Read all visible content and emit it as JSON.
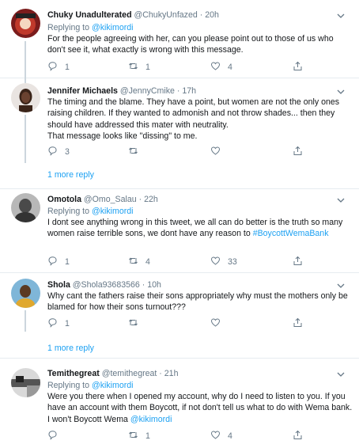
{
  "tweets": [
    {
      "name": "Chuky Unadulterated",
      "handle": "@ChukyUnfazed",
      "time": "20h",
      "replying_prefix": "Replying to",
      "replying_to": "@kikimordi",
      "text": "For the people agreeing with her, can you please point out to those of us who don't see it, what exactly is wrong with this message.",
      "replies": "1",
      "retweets": "1",
      "likes": "4"
    },
    {
      "name": "Jennifer Michaels",
      "handle": "@JennyCmike",
      "time": "17h",
      "text": "The timing and the blame. They have a point, but women are not the only ones raising children. If they wanted to admonish and not throw shades... then they should have addressed this mater with neutrality.\nThat message looks like \"dissing\" to me.",
      "replies": "3",
      "retweets": "",
      "likes": ""
    },
    {
      "name": "Omotola",
      "handle": "@Omo_Salau",
      "time": "22h",
      "replying_prefix": "Replying to",
      "replying_to": "@kikimordi",
      "text": "I dont see anything wrong in this tweet, we all can do better is the truth so many women raise terrible sons, we dont have any reason to",
      "hashtag": "#BoycottWemaBank",
      "replies": "1",
      "retweets": "4",
      "likes": "33"
    },
    {
      "name": "Shola",
      "handle": "@Shola93683566",
      "time": "10h",
      "text": "Why cant the fathers raise their sons appropriately why must the mothers only be blamed for how their sons turnout???",
      "replies": "1",
      "retweets": "",
      "likes": ""
    },
    {
      "name": "Temithegreat",
      "handle": "@temithegreat",
      "time": "21h",
      "replying_prefix": "Replying to",
      "replying_to": "@kikimordi",
      "text": "Were you there when I opened my account, why do I need to listen to you. If you have an account with them Boycott, if not don't tell us what to do with Wema bank. I won't Boycott Wema",
      "text_mention": "@kikimordi",
      "replies": "",
      "retweets": "1",
      "likes": "4"
    }
  ],
  "more_replies": "1 more reply",
  "dot": "·",
  "colors": {
    "text": "#14171a",
    "muted": "#657786",
    "link": "#1da1f2",
    "border": "#e6ecf0"
  },
  "icons": [
    "reply-icon",
    "retweet-icon",
    "like-icon",
    "share-icon",
    "caret-down-icon"
  ]
}
